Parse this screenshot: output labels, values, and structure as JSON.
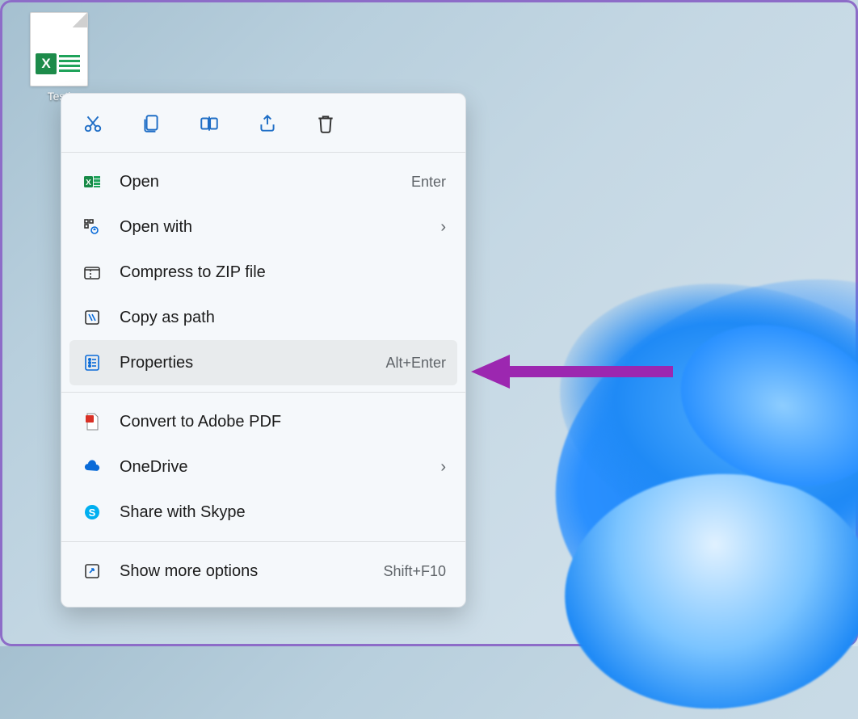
{
  "desktop": {
    "file_label": "Testi"
  },
  "context_menu": {
    "actions": {
      "cut": "cut-icon",
      "copy": "copy-icon",
      "rename": "rename-icon",
      "share": "share-icon",
      "delete": "delete-icon"
    },
    "items": [
      {
        "icon": "excel-icon",
        "label": "Open",
        "shortcut": "Enter",
        "chevron": false
      },
      {
        "icon": "open-with-icon",
        "label": "Open with",
        "shortcut": "",
        "chevron": true
      },
      {
        "icon": "zip-icon",
        "label": "Compress to ZIP file",
        "shortcut": "",
        "chevron": false
      },
      {
        "icon": "copy-path-icon",
        "label": "Copy as path",
        "shortcut": "",
        "chevron": false
      },
      {
        "icon": "properties-icon",
        "label": "Properties",
        "shortcut": "Alt+Enter",
        "chevron": false
      }
    ],
    "items2": [
      {
        "icon": "pdf-icon",
        "label": "Convert to Adobe PDF",
        "shortcut": "",
        "chevron": false
      },
      {
        "icon": "onedrive-icon",
        "label": "OneDrive",
        "shortcut": "",
        "chevron": true
      },
      {
        "icon": "skype-icon",
        "label": "Share with Skype",
        "shortcut": "",
        "chevron": false
      }
    ],
    "items3": [
      {
        "icon": "more-icon",
        "label": "Show more options",
        "shortcut": "Shift+F10",
        "chevron": false
      }
    ]
  },
  "annotation": {
    "color": "#9c27b0"
  }
}
